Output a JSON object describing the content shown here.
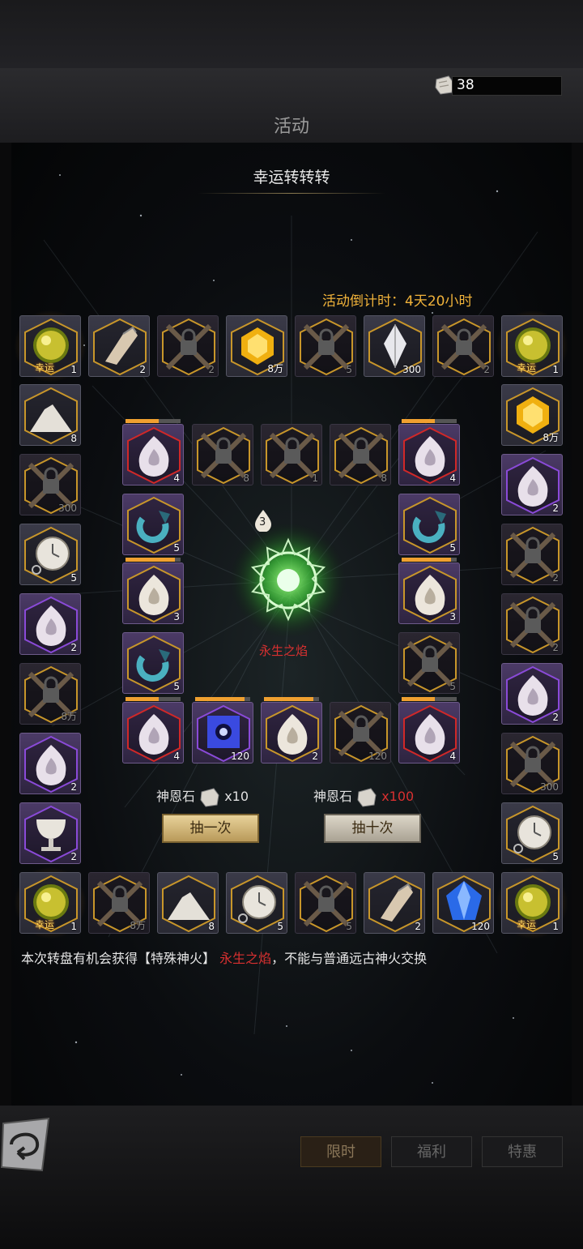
{
  "header": {
    "stone_count": "38",
    "tab_title": "活动"
  },
  "panel": {
    "title": "幸运转转转",
    "countdown": "活动倒计时：4天20小时",
    "center_label": "永生之焰",
    "center_badge": "3"
  },
  "lucky_label": "幸运",
  "outer_ring": [
    {
      "icon": "golden-orb",
      "qty": "1",
      "lucky": true
    },
    {
      "icon": "flint-stone",
      "qty": "2"
    },
    {
      "icon": "chained-lock",
      "qty": "2"
    },
    {
      "icon": "gold-gem",
      "qty": "8万"
    },
    {
      "icon": "chained-lock",
      "qty": "5"
    },
    {
      "icon": "white-crystal",
      "qty": "300"
    },
    {
      "icon": "chained-lock",
      "qty": "2"
    },
    {
      "icon": "golden-orb",
      "qty": "1",
      "lucky": true
    },
    {
      "icon": "gold-gem",
      "qty": "8万"
    },
    {
      "icon": "flame-purple",
      "qty": "2"
    },
    {
      "icon": "chained-lock",
      "qty": "2"
    },
    {
      "icon": "chained-lock",
      "qty": "2"
    },
    {
      "icon": "flame-purple",
      "qty": "2"
    },
    {
      "icon": "chained-lock",
      "qty": "300"
    },
    {
      "icon": "pocket-watch",
      "qty": "5"
    },
    {
      "icon": "golden-orb",
      "qty": "1",
      "lucky": true
    },
    {
      "icon": "blue-gem",
      "qty": "120"
    },
    {
      "icon": "flint-stone",
      "qty": "2"
    },
    {
      "icon": "chained-lock",
      "qty": "5"
    },
    {
      "icon": "pocket-watch",
      "qty": "5"
    },
    {
      "icon": "sand-pile",
      "qty": "8"
    },
    {
      "icon": "chained-lock",
      "qty": "8万"
    },
    {
      "icon": "golden-orb",
      "qty": "1",
      "lucky": true
    },
    {
      "icon": "chalice",
      "qty": "2"
    },
    {
      "icon": "flame-purple",
      "qty": "2"
    },
    {
      "icon": "chained-lock",
      "qty": "8万"
    },
    {
      "icon": "flame-purple",
      "qty": "2"
    },
    {
      "icon": "pocket-watch",
      "qty": "5"
    },
    {
      "icon": "chained-lock",
      "qty": "300"
    },
    {
      "icon": "sand-pile",
      "qty": "8"
    }
  ],
  "inner_ring": [
    {
      "icon": "flame-red",
      "qty": "4",
      "progress": 0.6
    },
    {
      "icon": "chained-lock",
      "qty": "8"
    },
    {
      "icon": "chained-lock",
      "qty": "1"
    },
    {
      "icon": "chained-lock",
      "qty": "8"
    },
    {
      "icon": "flame-red",
      "qty": "4",
      "progress": 0.6
    },
    {
      "icon": "serpent-ring",
      "qty": "5"
    },
    {
      "icon": "flame-gold",
      "qty": "3",
      "progress": 0.9
    },
    {
      "icon": "chained-lock",
      "qty": "5"
    },
    {
      "icon": "flame-red",
      "qty": "4",
      "progress": 0.6
    },
    {
      "icon": "chained-lock",
      "qty": "120"
    },
    {
      "icon": "flame-gold",
      "qty": "2",
      "progress": 0.9
    },
    {
      "icon": "blue-cube",
      "qty": "120",
      "progress": 0.9
    },
    {
      "icon": "flame-red",
      "qty": "4",
      "progress": 0.6
    },
    {
      "icon": "serpent-ring",
      "qty": "5"
    },
    {
      "icon": "flame-gold",
      "qty": "3",
      "progress": 0.9
    },
    {
      "icon": "serpent-ring",
      "qty": "5"
    }
  ],
  "draw": {
    "single_cost_label": "神恩石",
    "single_cost_qty": "x10",
    "ten_cost_label": "神恩石",
    "ten_cost_qty": "x100",
    "single_button": "抽一次",
    "ten_button": "抽十次"
  },
  "description": {
    "part1": "本次转盘有机会获得【特殊神火】",
    "highlight": "永生之焰",
    "part2": "，不能与普通远古神火交换"
  },
  "nav": {
    "tab1": "限时",
    "tab2": "福利",
    "tab3": "特惠"
  },
  "colors": {
    "accent": "#f0b23a",
    "highlight_red": "#d83030"
  }
}
